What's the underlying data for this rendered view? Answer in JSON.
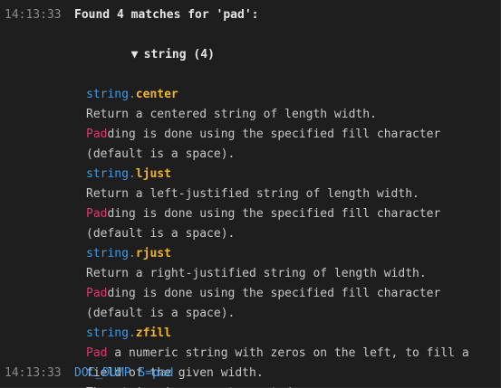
{
  "entries": [
    {
      "timestamp": "14:13:33",
      "header": "Found 4 matches for 'pad':",
      "group": {
        "toggle_icon": "▼",
        "label": "string (4)"
      },
      "matches": [
        {
          "module": "string",
          "dot": ".",
          "name": "center",
          "lines": [
            {
              "pre": "",
              "hl": "",
              "post": "Return a centered string of length width."
            },
            {
              "pre": "",
              "hl": "Pad",
              "post": "ding is done using the specified fill character"
            },
            {
              "pre": "",
              "hl": "",
              "post": "(default is a space)."
            }
          ]
        },
        {
          "module": "string",
          "dot": ".",
          "name": "ljust",
          "lines": [
            {
              "pre": "",
              "hl": "",
              "post": "Return a left-justified string of length width."
            },
            {
              "pre": "",
              "hl": "Pad",
              "post": "ding is done using the specified fill character"
            },
            {
              "pre": "",
              "hl": "",
              "post": "(default is a space)."
            }
          ]
        },
        {
          "module": "string",
          "dot": ".",
          "name": "rjust",
          "lines": [
            {
              "pre": "",
              "hl": "",
              "post": "Return a right-justified string of length width."
            },
            {
              "pre": "",
              "hl": "Pad",
              "post": "ding is done using the specified fill character"
            },
            {
              "pre": "",
              "hl": "",
              "post": "(default is a space)."
            }
          ]
        },
        {
          "module": "string",
          "dot": ".",
          "name": "zfill",
          "lines": [
            {
              "pre": "",
              "hl": "Pad",
              "post": " a numeric string with zeros on the left, to fill a"
            },
            {
              "pre": "",
              "hl": "",
              "post": "field of the given width."
            },
            {
              "pre": "",
              "hl": "",
              "post": "The string is never truncated."
            }
          ]
        }
      ]
    },
    {
      "timestamp": "14:13:33",
      "command": "DOC_DUMP S=pad"
    }
  ],
  "colors": {
    "background": "#1e1e1e",
    "timestamp": "#8a8a8a",
    "module": "#3d9be9",
    "function": "#f0b429",
    "highlight": "#e0356f",
    "text": "#c8c8c8",
    "command": "#3d9be9"
  }
}
